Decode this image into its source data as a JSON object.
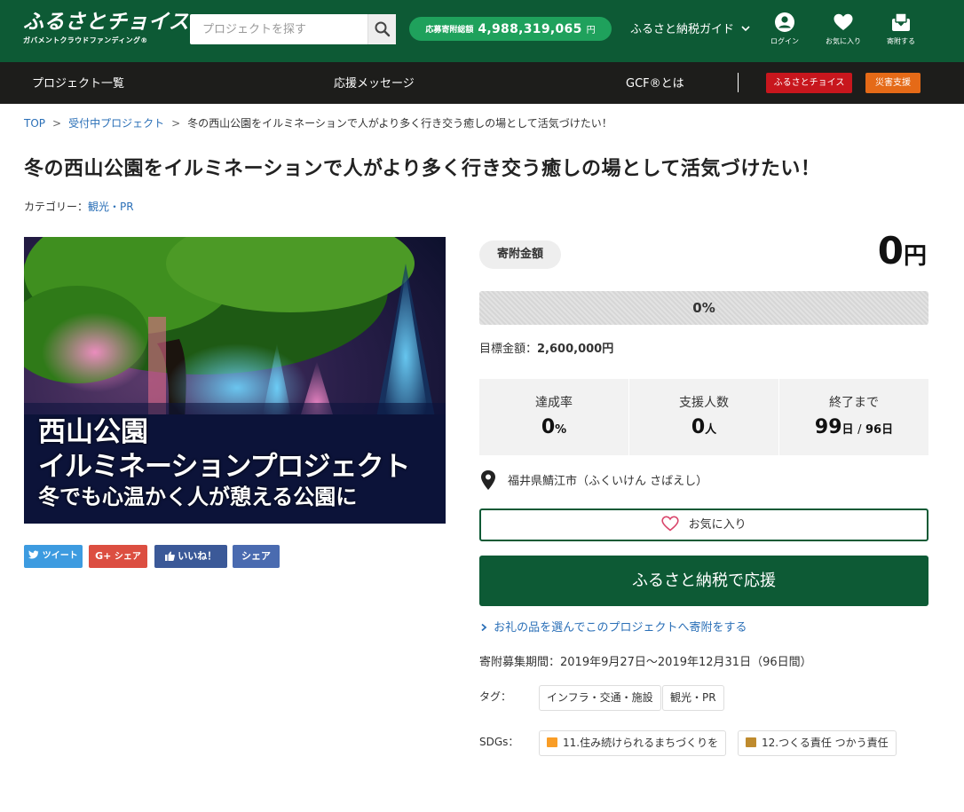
{
  "header": {
    "logo_main": "ふるさとチョイス",
    "logo_sub": "ガバメントクラウドファンディング®",
    "search_placeholder": "プロジェクトを探す",
    "total_label": "応募寄附総額",
    "total_value": "4,988,319,065",
    "total_unit": "円",
    "guide_label": "ふるさと納税ガイド",
    "icons": {
      "login": "ログイン",
      "favorites": "お気に入り",
      "donate": "寄附する"
    }
  },
  "nav": {
    "projects": "プロジェクト一覧",
    "messages": "応援メッセージ",
    "about": "GCF®とは",
    "choice_tag": "ふるさとチョイス",
    "disaster_tag": "災害支援"
  },
  "breadcrumb": {
    "top": "TOP",
    "accepting": "受付中プロジェクト",
    "current": "冬の西山公園をイルミネーションで人がより多く行き交う癒しの場として活気づけたい！"
  },
  "page_title": "冬の西山公園をイルミネーションで人がより多く行き交う癒しの場として活気づけたい！",
  "category": {
    "label": "カテゴリー：",
    "value": "観光・PR"
  },
  "hero": {
    "line1": "西山公園",
    "line2": "イルミネーションプロジェクト",
    "line3": "冬でも心温かく人が憩える公園に"
  },
  "share": {
    "tweet": "ツイート",
    "gplus": "シェア",
    "like": "いいね！",
    "fb_share": "シェア"
  },
  "funding": {
    "amount_label": "寄附金額",
    "amount_value": "0",
    "amount_unit": "円",
    "progress_percent": "0%",
    "progress_fraction": 0,
    "goal_label": "目標金額：",
    "goal_value": "2,600,000円"
  },
  "stats": {
    "rate_label": "達成率",
    "rate_value": "0",
    "rate_unit": "%",
    "supporters_label": "支援人数",
    "supporters_value": "0",
    "supporters_unit": "人",
    "remaining_label": "終了まで",
    "remaining_value": "99",
    "remaining_unit": "日",
    "remaining_sep": "/",
    "remaining_total": "96日"
  },
  "location": "福井県鯖江市（ふくいけん さばえし）",
  "favorite_button": "お気に入り",
  "cta_button": "ふるさと納税で応援",
  "gift_link": "お礼の品を選んでこのプロジェクトへ寄附をする",
  "period": "寄附募集期間：2019年9月27日～2019年12月31日（96日間）",
  "tags": {
    "label": "タグ：",
    "items": [
      "インフラ・交通・施設",
      "観光・PR"
    ]
  },
  "sdgs": {
    "label": "SDGs：",
    "items": [
      "11.住み続けられるまちづくりを",
      "12.つくる責任 つかう責任"
    ]
  },
  "colors": {
    "brand_green": "#0d5a35",
    "accent_green": "#1fa15c",
    "nav_dark": "#1d1d1b",
    "link_blue": "#2a6fb7",
    "choice_red": "#c8161d",
    "disaster_orange": "#e56a17"
  }
}
